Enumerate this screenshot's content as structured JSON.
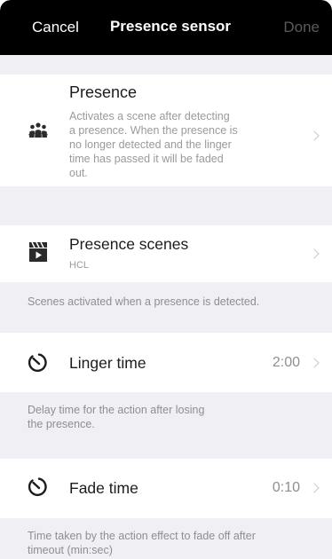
{
  "nav": {
    "cancel_label": "Cancel",
    "title": "Presence sensor",
    "done_label": "Done"
  },
  "presence": {
    "title": "Presence",
    "description_lines": [
      "Activates a scene after detecting",
      "a presence. When the presence is",
      "no longer detected and the linger",
      "time has passed it will be faded",
      "out."
    ],
    "icon": "people-group-icon"
  },
  "presence_scenes": {
    "title": "Presence scenes",
    "subtitle": "HCL",
    "icon": "clapperboard-icon",
    "footer": "Scenes activated when a presence is detected."
  },
  "linger_time": {
    "title": "Linger time",
    "value": "2:00",
    "icon": "timer-icon",
    "footer_lines": [
      "Delay time for the action after losing",
      "the presence."
    ]
  },
  "fade_time": {
    "title": "Fade time",
    "value": "0:10",
    "icon": "timer-icon",
    "footer_lines": [
      "Time taken by the action effect to fade off after",
      "timeout (min:sec)"
    ]
  }
}
